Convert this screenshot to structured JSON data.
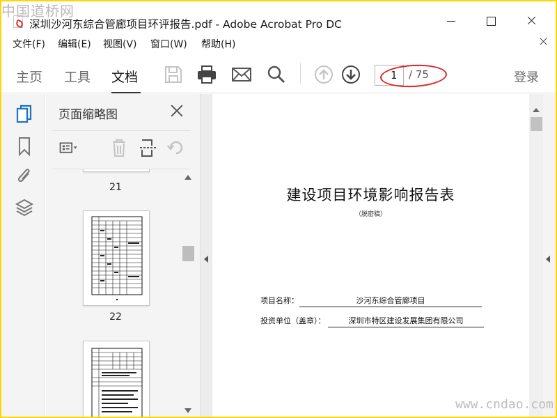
{
  "watermark_top": "中国道桥网",
  "watermark_bottom": "www.cndao.com",
  "window": {
    "title": "深圳沙河东综合管廊项目环评报告.pdf - Adobe Acrobat Pro DC"
  },
  "menu": [
    "文件(F)",
    "编辑(E)",
    "视图(V)",
    "窗口(W)",
    "帮助(H)"
  ],
  "toolbar": {
    "tabs": [
      "主页",
      "工具",
      "文档"
    ],
    "active_tab": "文档",
    "current_page": "1",
    "total_pages": "/ 75",
    "login": "登录"
  },
  "thumbnails": {
    "title": "页面缩略图",
    "pages": [
      "21",
      "22"
    ]
  },
  "document": {
    "title": "建设项目环境影响报告表",
    "subtitle": "（脱密稿）",
    "fields": [
      {
        "label": "项目名称：",
        "value": "沙河东综合管廊项目"
      },
      {
        "label": "投资单位（盖章）：",
        "value": "深圳市特区建设发展集团有限公司"
      }
    ]
  },
  "colors": {
    "highlight_ellipse": "#e02020",
    "border": "#ffd700"
  }
}
